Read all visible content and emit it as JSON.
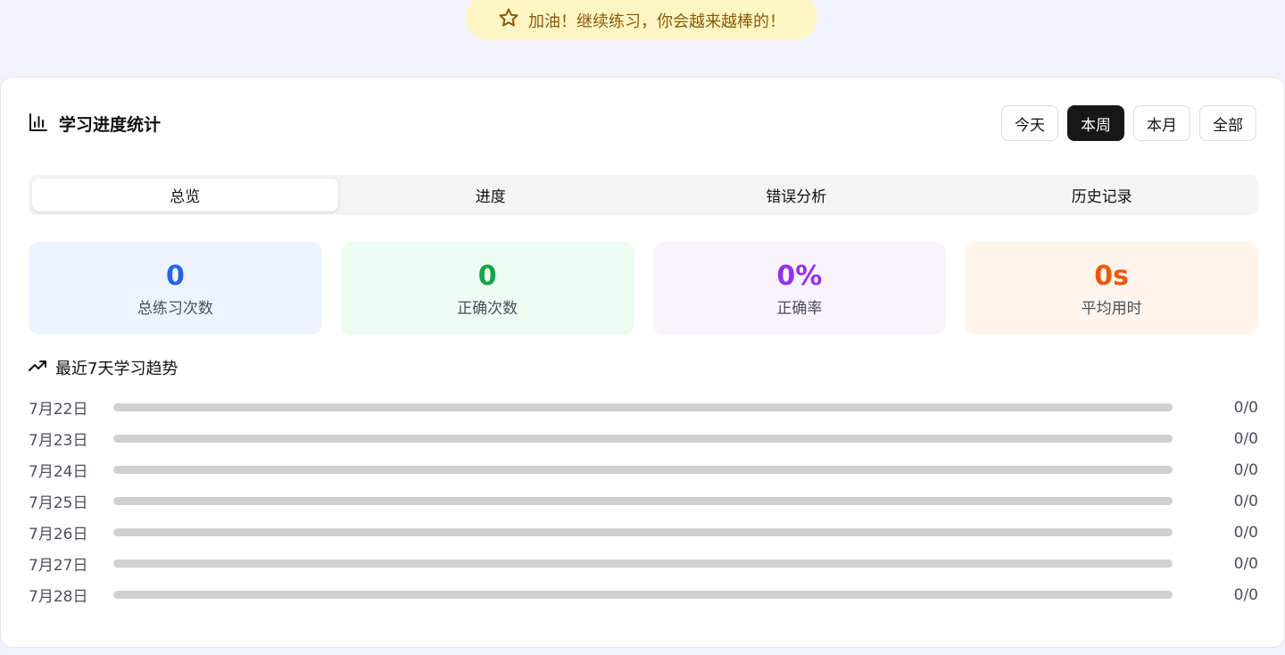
{
  "banner": {
    "text": "加油！继续练习，你会越来越棒的！",
    "icon": "star-icon"
  },
  "card": {
    "title": "学习进度统计",
    "icon": "bar-chart-icon",
    "ranges": [
      {
        "label": "今天",
        "active": false
      },
      {
        "label": "本周",
        "active": true
      },
      {
        "label": "本月",
        "active": false
      },
      {
        "label": "全部",
        "active": false
      }
    ],
    "tabs": [
      {
        "label": "总览",
        "active": true
      },
      {
        "label": "进度",
        "active": false
      },
      {
        "label": "错误分析",
        "active": false
      },
      {
        "label": "历史记录",
        "active": false
      }
    ]
  },
  "stats": [
    {
      "value": "0",
      "label": "总练习次数",
      "color": "#2563eb",
      "bg": "#eef4ff"
    },
    {
      "value": "0",
      "label": "正确次数",
      "color": "#16a34a",
      "bg": "#ecfcf2"
    },
    {
      "value": "0%",
      "label": "正确率",
      "color": "#9333ea",
      "bg": "#f9f3ff"
    },
    {
      "value": "0s",
      "label": "平均用时",
      "color": "#ea580c",
      "bg": "#fff5ec"
    }
  ],
  "trend": {
    "title": "最近7天学习趋势",
    "icon": "trending-up-icon",
    "rows": [
      {
        "date": "7月22日",
        "count": "0/0",
        "progress": 0
      },
      {
        "date": "7月23日",
        "count": "0/0",
        "progress": 0
      },
      {
        "date": "7月24日",
        "count": "0/0",
        "progress": 0
      },
      {
        "date": "7月25日",
        "count": "0/0",
        "progress": 0
      },
      {
        "date": "7月26日",
        "count": "0/0",
        "progress": 0
      },
      {
        "date": "7月27日",
        "count": "0/0",
        "progress": 0
      },
      {
        "date": "7月28日",
        "count": "0/0",
        "progress": 0
      }
    ]
  }
}
